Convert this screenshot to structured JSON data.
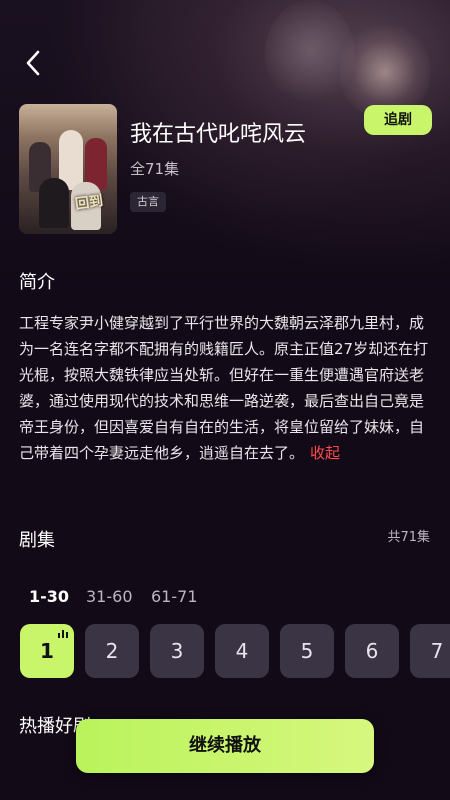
{
  "drama": {
    "title": "我在古代叱咤风云",
    "episodes_label": "全71集",
    "tag": "古言",
    "follow_label": "追剧",
    "poster_logo": "回到"
  },
  "synopsis": {
    "heading": "简介",
    "text": "工程专家尹小健穿越到了平行世界的大魏朝云泽郡九里村，成为一名连名字都不配拥有的贱籍匠人。原主正值27岁却还在打光棍，按照大魏铁律应当处斩。但好在一重生便遭遇官府送老婆，通过使用现代的技术和思维一路逆袭，最后查出自己竟是帝王身份，但因喜爱自有自在的生活，将皇位留给了妹妹，自己带着四个孕妻远走他乡，逍遥自在去了。",
    "collapse_label": "收起"
  },
  "episodes": {
    "heading": "剧集",
    "total_label": "共71集",
    "ranges": [
      "1-30",
      "31-60",
      "61-71"
    ],
    "active_range": 0,
    "items": [
      "1",
      "2",
      "3",
      "4",
      "5",
      "6",
      "7"
    ],
    "active_episode": 0
  },
  "hot": {
    "heading": "热播好剧"
  },
  "continue_label": "继续播放",
  "colors": {
    "accent": "#c8f56a",
    "background": "#120a17",
    "collapse_link": "#ff4b4b",
    "tile": "#3a3444"
  },
  "icons": {
    "back": "chevron-left-icon",
    "playing": "playing-bars-icon"
  }
}
